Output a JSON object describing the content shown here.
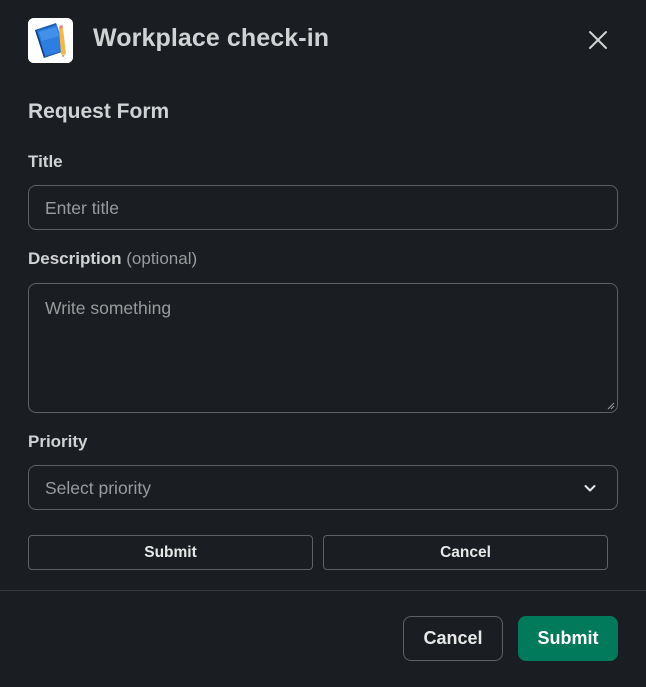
{
  "modal": {
    "title": "Workplace check-in",
    "icon": "notebook-pencil-icon",
    "close_icon": "close-icon"
  },
  "form": {
    "heading": "Request Form",
    "title_field": {
      "label": "Title",
      "placeholder": "Enter title"
    },
    "description_field": {
      "label": "Description",
      "optional_text": "(optional)",
      "placeholder": "Write something"
    },
    "priority_field": {
      "label": "Priority",
      "placeholder": "Select priority"
    },
    "actions": {
      "submit_label": "Submit",
      "cancel_label": "Cancel"
    }
  },
  "footer": {
    "cancel_label": "Cancel",
    "submit_label": "Submit"
  },
  "colors": {
    "background": "#1a1d21",
    "text": "#d1d2d3",
    "muted_text": "#9a9b9d",
    "border": "#5e6064",
    "primary_button": "#007a5a"
  }
}
